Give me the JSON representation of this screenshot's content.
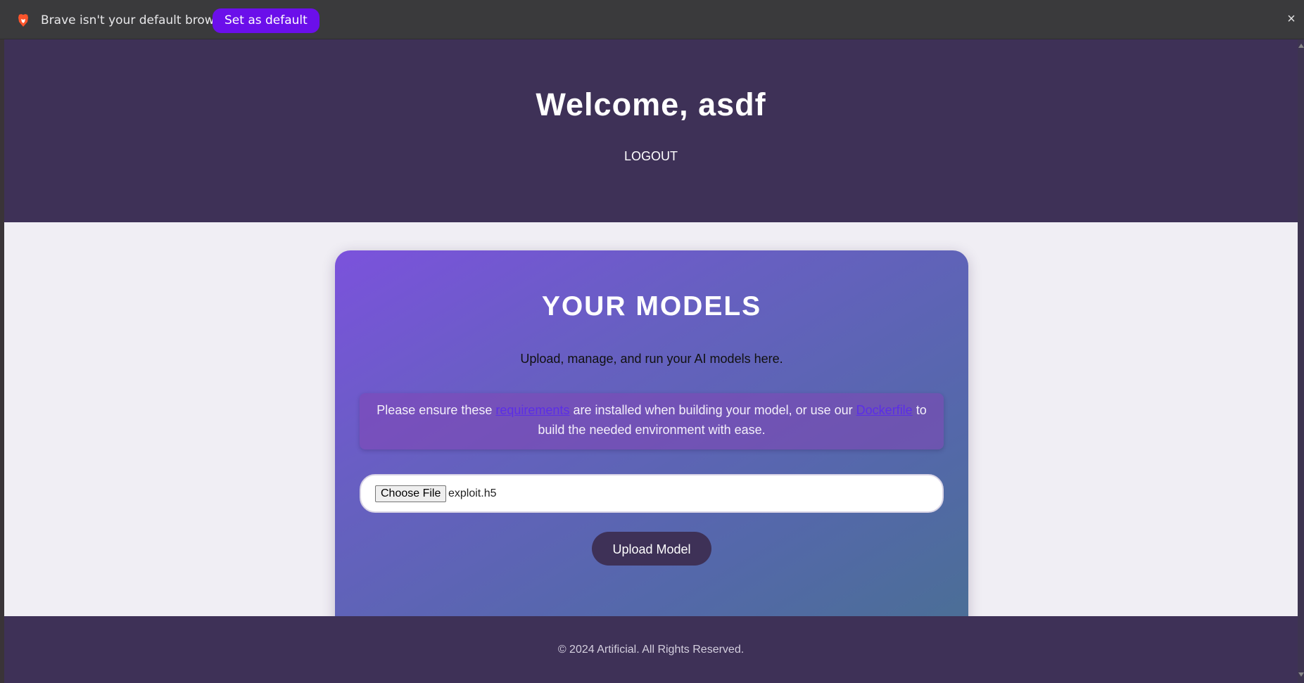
{
  "browser": {
    "notification_text": "Brave isn't your default browser",
    "set_default_label": "Set as default",
    "close_label": "×",
    "logo_icon": "brave-lion-icon",
    "brand_color": "#6b0fea"
  },
  "header": {
    "welcome": "Welcome, asdf",
    "logout": "LOGOUT",
    "background": "#3e3157"
  },
  "models": {
    "title": "YOUR MODELS",
    "subtitle": "Upload, manage, and run your AI models here.",
    "notice": {
      "before": "Please ensure these ",
      "link1": "requirements",
      "middle": " are installed when building your model, or use our ",
      "link2": "Dockerfile",
      "after": " to build the needed environment with ease."
    },
    "file_input": {
      "button_label": "Choose File",
      "selected_file": "exploit.h5"
    },
    "upload_label": "Upload Model"
  },
  "footer": {
    "text": "© 2024 Artificial. All Rights Reserved."
  }
}
